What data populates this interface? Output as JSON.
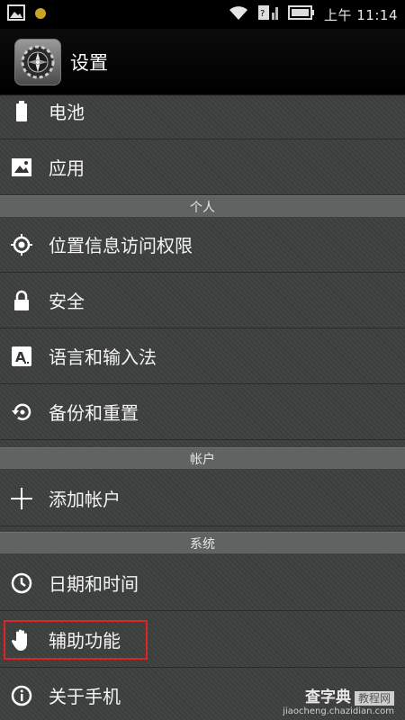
{
  "status_bar": {
    "time": "上午 11:14",
    "icons": [
      "image-icon",
      "notification-dot-icon",
      "wifi-icon",
      "sim-icon",
      "battery-icon"
    ]
  },
  "action_bar": {
    "title": "设置",
    "icon": "settings-gear-icon"
  },
  "items": [
    {
      "label": "电池",
      "icon": "battery-icon"
    },
    {
      "label": "应用",
      "icon": "apps-icon"
    },
    {
      "label": "位置信息访问权限",
      "icon": "location-icon"
    },
    {
      "label": "安全",
      "icon": "lock-icon"
    },
    {
      "label": "语言和输入法",
      "icon": "language-icon"
    },
    {
      "label": "备份和重置",
      "icon": "backup-reset-icon"
    },
    {
      "label": "添加帐户",
      "icon": "add-icon"
    },
    {
      "label": "日期和时间",
      "icon": "clock-icon"
    },
    {
      "label": "辅助功能",
      "icon": "hand-icon"
    },
    {
      "label": "关于手机",
      "icon": "info-icon"
    }
  ],
  "sections": {
    "personal": "个人",
    "accounts": "帐户",
    "system": "系统"
  },
  "watermark": {
    "brand": "查字典",
    "tag": "教程网",
    "url": "jiaocheng.chazidian.com"
  },
  "colors": {
    "highlight": "#e02424",
    "section_header": "#616363"
  }
}
